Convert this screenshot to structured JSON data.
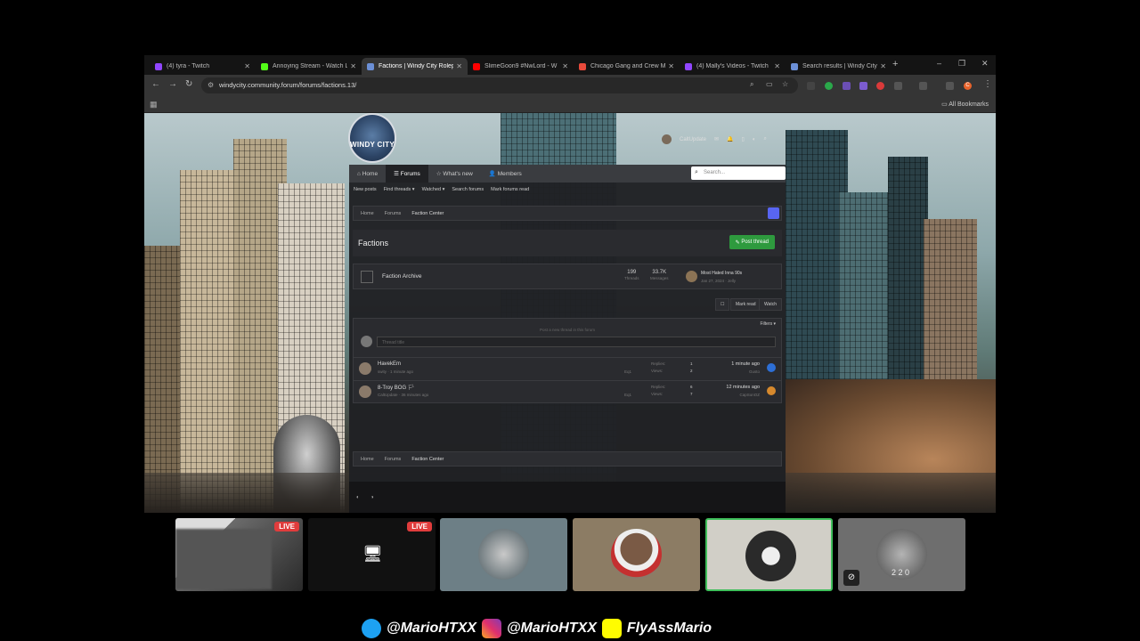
{
  "browser": {
    "tabs": [
      {
        "title": "(4) tyra - Twitch",
        "color": "#9146ff"
      },
      {
        "title": "Annoying Stream - Watch L",
        "color": "#53fc18"
      },
      {
        "title": "Factions | Windy City Rolep",
        "color": "#6b8fd6",
        "active": true
      },
      {
        "title": "SlimeGoon9 #NwLord - W",
        "color": "#ff0000"
      },
      {
        "title": "Chicago Gang and Crew M",
        "color": "#e84a3b"
      },
      {
        "title": "(4) Mally's Videos - Twitch",
        "color": "#9146ff"
      },
      {
        "title": "Search results | Windy City",
        "color": "#6b8fd6"
      }
    ],
    "new_tab": "+",
    "url": "windycity.community.forum/forums/factions.13/",
    "all_bookmarks": "All Bookmarks",
    "profile_initial": "C"
  },
  "forum": {
    "logo_text": "WINDY CITY",
    "username": "CaltUpdate",
    "nav": [
      "Home",
      "Forums",
      "What's new",
      "Members"
    ],
    "search_placeholder": "Search...",
    "subnav": [
      "New posts",
      "Find threads ▾",
      "Watched ▾",
      "Search forums",
      "Mark forums read"
    ],
    "breadcrumbs": [
      "Home",
      "Forums",
      "Faction Center"
    ],
    "page_title": "Factions",
    "post_thread": "Post thread",
    "subforum": {
      "name": "Faction Archive",
      "threads": "199",
      "threads_label": "Threads",
      "messages": "33.7K",
      "messages_label": "Messages",
      "latest_title": "Most Hated Inna 90s",
      "latest_date": "Jan 27, 2024 · Jelly"
    },
    "actions": {
      "mark_read": "Mark read",
      "watch": "Watch"
    },
    "filters": "Filters ▾",
    "new_thread_hint": "Post a new thread in this forum",
    "thread_title_placeholder": "Thread title",
    "threads": [
      {
        "title": "HavekEm",
        "meta": "swity · 1 minute ago",
        "pages": "Eq1",
        "replies_label": "Replies:",
        "replies": "1",
        "views_label": "Views:",
        "views": "2",
        "time": "1 minute ago",
        "by": "Gusto",
        "avatar_color": "#2d6fd6"
      },
      {
        "title": "8-Troy BOG 🏳",
        "meta": "CaltUpdate · 36 minutes ago",
        "pages": "Eq1",
        "replies_label": "Replies:",
        "replies": "6",
        "views_label": "Views:",
        "views": "7",
        "time": "12 minutes ago",
        "by": "CapSonOZ",
        "avatar_color": "#d6892d"
      }
    ],
    "bottom_breadcrumbs": [
      "Home",
      "Forums",
      "Faction Center"
    ]
  },
  "stream": {
    "live_label": "LIVE",
    "tile_five_caption": "2 2 0"
  },
  "social": {
    "twitter": "@MarioHTXX",
    "instagram": "@MarioHTXX",
    "snapchat": "FlyAssMario"
  }
}
